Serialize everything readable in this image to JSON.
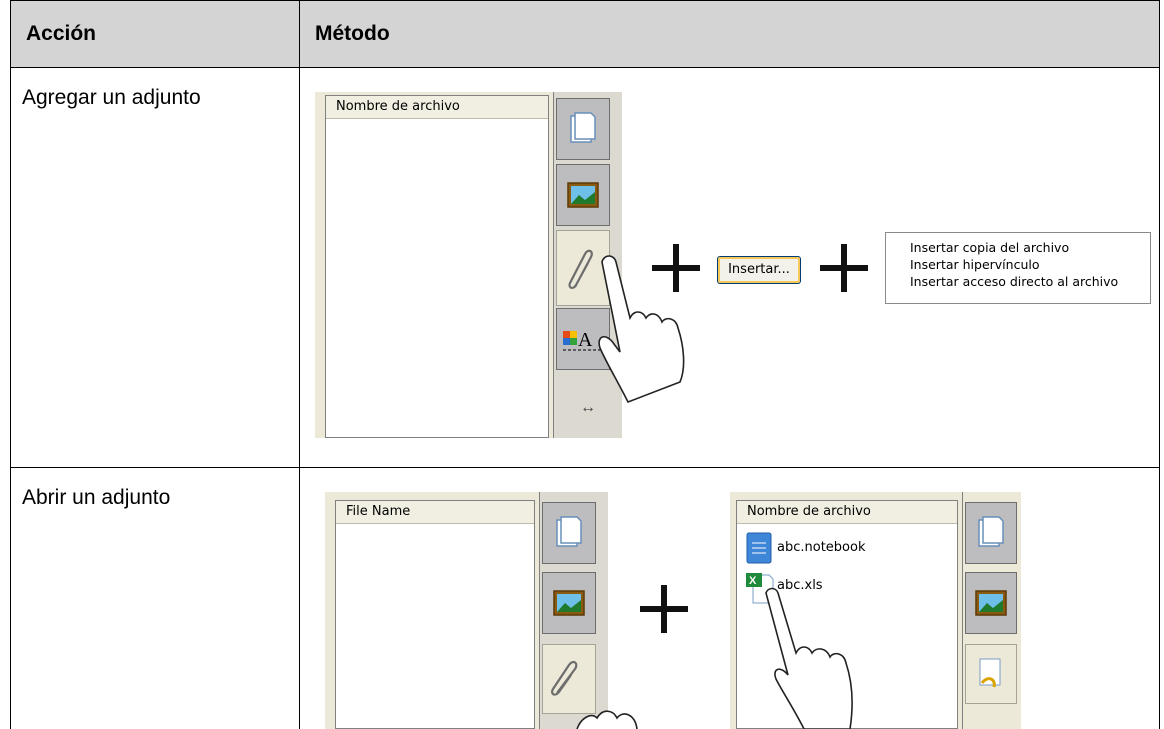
{
  "table": {
    "headers": {
      "action": "Acción",
      "method": "Método"
    },
    "rows": [
      {
        "action": "Agregar un adjunto",
        "screenshot": {
          "list_header": "Nombre de archivo",
          "insert_button": "Insertar...",
          "menu_items": [
            "Insertar copia del archivo",
            "Insertar hipervínculo",
            "Insertar acceso directo al archivo"
          ],
          "resize_glyph": "↔"
        }
      },
      {
        "action": "Abrir un adjunto",
        "screenshot": {
          "left_list_header": "File Name",
          "right_list_header": "Nombre de archivo",
          "files": [
            "abc.notebook",
            "abc.xls"
          ]
        }
      }
    ]
  }
}
